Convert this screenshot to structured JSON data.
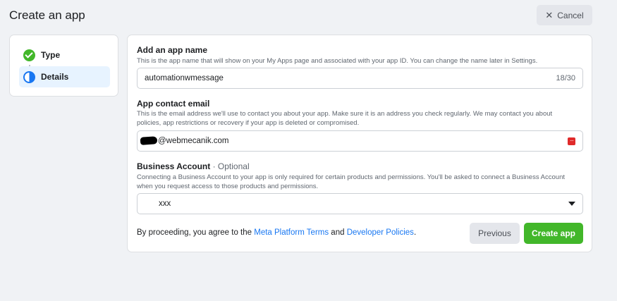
{
  "header": {
    "title": "Create an app",
    "cancel_label": "Cancel"
  },
  "steps": [
    {
      "label": "Type",
      "status": "complete",
      "icon": "check-circle-icon"
    },
    {
      "label": "Details",
      "status": "in-progress",
      "icon": "half-circle-icon"
    }
  ],
  "form": {
    "app_name": {
      "label": "Add an app name",
      "help": "This is the app name that will show on your My Apps page and associated with your app ID. You can change the name later in Settings.",
      "value": "automationwmessage",
      "counter": "18/30"
    },
    "contact_email": {
      "label": "App contact email",
      "help": "This is the email address we'll use to contact you about your app. Make sure it is an address you check regularly. We may contact you about policies, app restrictions or recovery if your app is deleted or compromised.",
      "value": "@webmecanik.com",
      "icon": "password-manager-icon"
    },
    "business_account": {
      "label": "Business Account",
      "optional": "· Optional",
      "help": "Connecting a Business Account to your app is only required for certain products and permissions. You'll be asked to connect a Business Account when you request access to those products and permissions.",
      "value": "xxx"
    }
  },
  "footer": {
    "prefix": "By proceeding, you agree to the ",
    "terms_link": "Meta Platform Terms",
    "and": " and ",
    "policies_link": "Developer Policies",
    "suffix": ".",
    "previous_label": "Previous",
    "create_label": "Create app"
  },
  "colors": {
    "accent": "#1877f2",
    "success": "#42b72a",
    "background": "#f0f2f5"
  }
}
